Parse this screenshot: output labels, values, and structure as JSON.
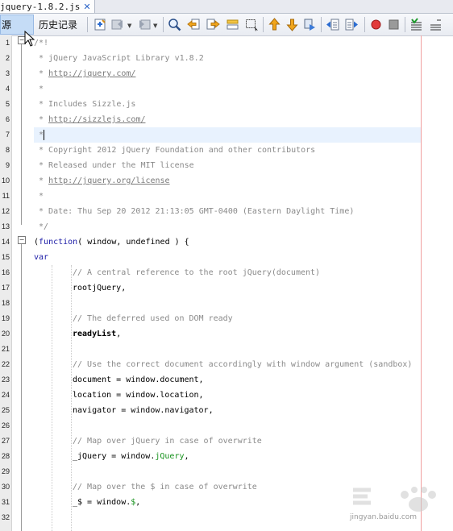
{
  "tab": {
    "title": "jquery-1.8.2.js",
    "close": "✕"
  },
  "toolbar": {
    "source_label": "源",
    "history_label": "历史记录"
  },
  "gutter": {
    "line_numbers": [
      "1",
      "2",
      "3",
      "4",
      "5",
      "6",
      "7",
      "8",
      "9",
      "10",
      "11",
      "12",
      "13",
      "14",
      "15",
      "16",
      "17",
      "18",
      "19",
      "20",
      "21",
      "22",
      "23",
      "24",
      "25",
      "26",
      "27",
      "28",
      "29",
      "30",
      "31",
      "32"
    ],
    "fold_collapse": "−"
  },
  "code": {
    "l1": "/*!",
    "l2": " * jQuery JavaScript Library v1.8.2",
    "l3_prefix": " * ",
    "l3_link": "http://jquery.com/",
    "l4": " *",
    "l5": " * Includes Sizzle.js",
    "l6_prefix": " * ",
    "l6_link": "http://sizzlejs.com/",
    "l7": " *",
    "l8": " * Copyright 2012 jQuery Foundation and other contributors",
    "l9": " * Released under the MIT license",
    "l10_prefix": " * ",
    "l10_link": "http://jquery.org/license",
    "l11": " *",
    "l12": " * Date: Thu Sep 20 2012 21:13:05 GMT-0400 (Eastern Daylight Time)",
    "l13": " */",
    "l14_paren": "(",
    "l14_kw": "function",
    "l14_rest": "( window, undefined ) {",
    "l15": "var",
    "l16": "// A central reference to the root jQuery(document)",
    "l17": "rootjQuery,",
    "l19": "// The deferred used on DOM ready",
    "l20_bold": "readyList",
    "l20_rest": ",",
    "l22": "// Use the correct document accordingly with window argument (sandbox)",
    "l23": "document = window.document,",
    "l24": "location = window.location,",
    "l25": "navigator = window.navigator,",
    "l27": "// Map over jQuery in case of overwrite",
    "l28_pre": "_jQuery = window.",
    "l28_green": "jQuery",
    "l28_post": ",",
    "l30": "// Map over the $ in case of overwrite",
    "l31_pre": "_$ = window.",
    "l31_green": "$",
    "l31_post": ","
  },
  "watermark": {
    "text": "jingyan.baidu.com"
  },
  "colors": {
    "accent": "#c5dcf6",
    "keyword": "#1a1aa6",
    "comment": "#8a8a8a",
    "global": "#16921c",
    "margin_line": "#f0a0a0"
  }
}
